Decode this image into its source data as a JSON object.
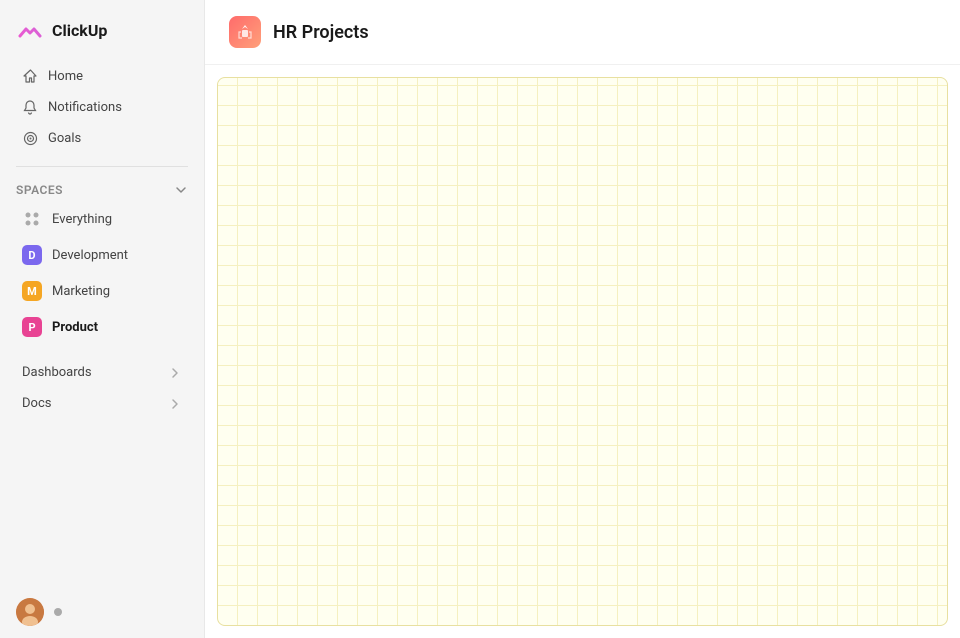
{
  "logo": {
    "text": "ClickUp"
  },
  "nav": {
    "home_label": "Home",
    "notifications_label": "Notifications",
    "goals_label": "Goals"
  },
  "spaces": {
    "section_label": "Spaces",
    "items": [
      {
        "id": "everything",
        "label": "Everything",
        "type": "everything",
        "color": null
      },
      {
        "id": "development",
        "label": "Development",
        "type": "badge",
        "color": "#7B68EE",
        "letter": "D"
      },
      {
        "id": "marketing",
        "label": "Marketing",
        "type": "badge",
        "color": "#F5A623",
        "letter": "M"
      },
      {
        "id": "product",
        "label": "Product",
        "type": "badge",
        "color": "#E84393",
        "letter": "P",
        "active": true
      }
    ]
  },
  "collapsibles": {
    "dashboards_label": "Dashboards",
    "docs_label": "Docs"
  },
  "header": {
    "title": "HR Projects"
  },
  "icons": {
    "home": "🏠",
    "notification": "🔔",
    "goal": "🎯",
    "chevron_down": "▾",
    "chevron_right": "›"
  }
}
